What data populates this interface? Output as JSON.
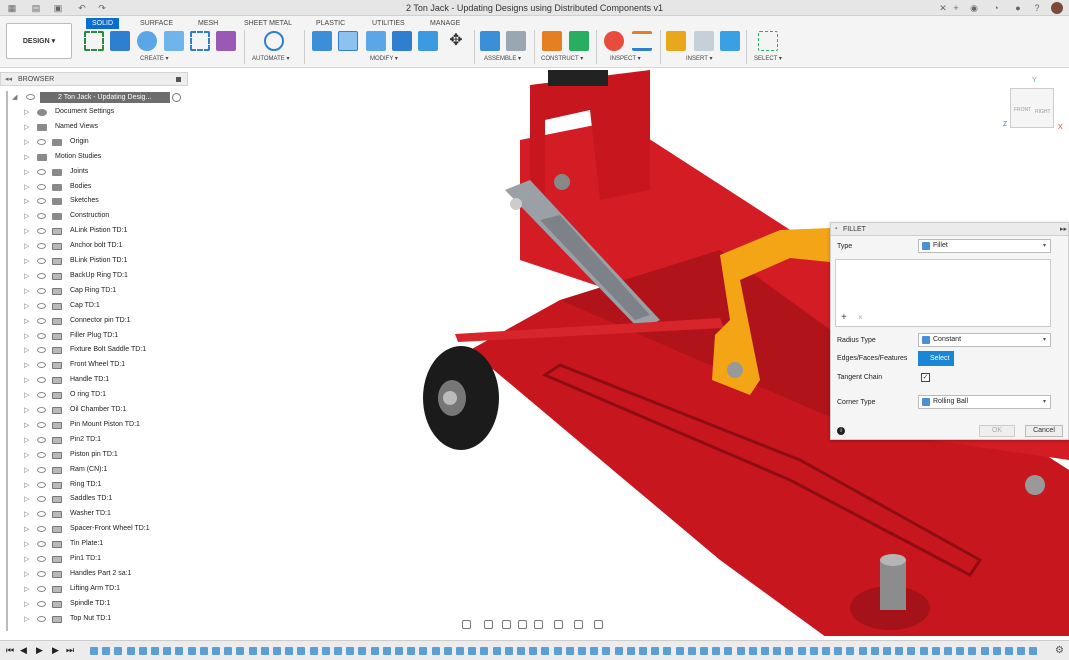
{
  "window": {
    "title": "2 Ton Jack - Updating Designs using Distributed Components v1"
  },
  "toolbar": {
    "workspace": "DESIGN ▾",
    "tabs": [
      "SOLID",
      "SURFACE",
      "MESH",
      "SHEET METAL",
      "PLASTIC",
      "UTILITIES",
      "MANAGE"
    ],
    "active_tab": "SOLID",
    "groups": [
      "CREATE ▾",
      "AUTOMATE ▾",
      "MODIFY ▾",
      "ASSEMBLE ▾",
      "CONSTRUCT ▾",
      "INSPECT ▾",
      "INSERT ▾",
      "SELECT ▾"
    ]
  },
  "browser": {
    "title": "BROWSER",
    "root": "2 Ton Jack - Updating Desig...",
    "items": [
      "Document Settings",
      "Named Views",
      "Origin",
      "Motion Studies",
      "Joints",
      "Bodies",
      "Sketches",
      "Construction",
      "ALink Pistion TD:1",
      "Anchor bolt TD:1",
      "BLink Pistion TD:1",
      "BackUp Ring TD:1",
      "Cap Ring TD:1",
      "Cap TD:1",
      "Connector pin TD:1",
      "Filler Plug TD:1",
      "Fixture Bolt Saddle TD:1",
      "Front Wheel TD:1",
      "Handle TD:1",
      "O ring TD:1",
      "Oil Chamber TD:1",
      "Pin Mount Piston TD:1",
      "Pin2 TD:1",
      "Piston pin TD:1",
      "Ram (CN):1",
      "Ring TD:1",
      "Saddles TD:1",
      "Washer TD:1",
      "Spacer-Front Wheel TD:1",
      "Tin Plate:1",
      "Pin1 TD:1",
      "Handles Part 2 sa:1",
      "Lifting Arm TD:1",
      "Spindle TD:1",
      "Top Nut TD:1"
    ]
  },
  "fillet": {
    "title": "FILLET",
    "type_label": "Type",
    "type_value": "Fillet",
    "radius_label": "Radius Type",
    "radius_value": "Constant",
    "edges_label": "Edges/Faces/Features",
    "select_label": "Select",
    "tangent_label": "Tangent Chain",
    "corner_label": "Corner Type",
    "corner_value": "Rolling Ball",
    "add": "+",
    "remove": "×",
    "ok": "OK",
    "cancel": "Cancel"
  },
  "viewcube": {
    "front": "FRONT",
    "right": "RIGHT",
    "axis_x": "X",
    "axis_y": "Y",
    "axis_z": "Z"
  },
  "colors": {
    "accent": "#0a6ed1",
    "model_red": "#c8161e",
    "handle_orange": "#f3a516"
  }
}
